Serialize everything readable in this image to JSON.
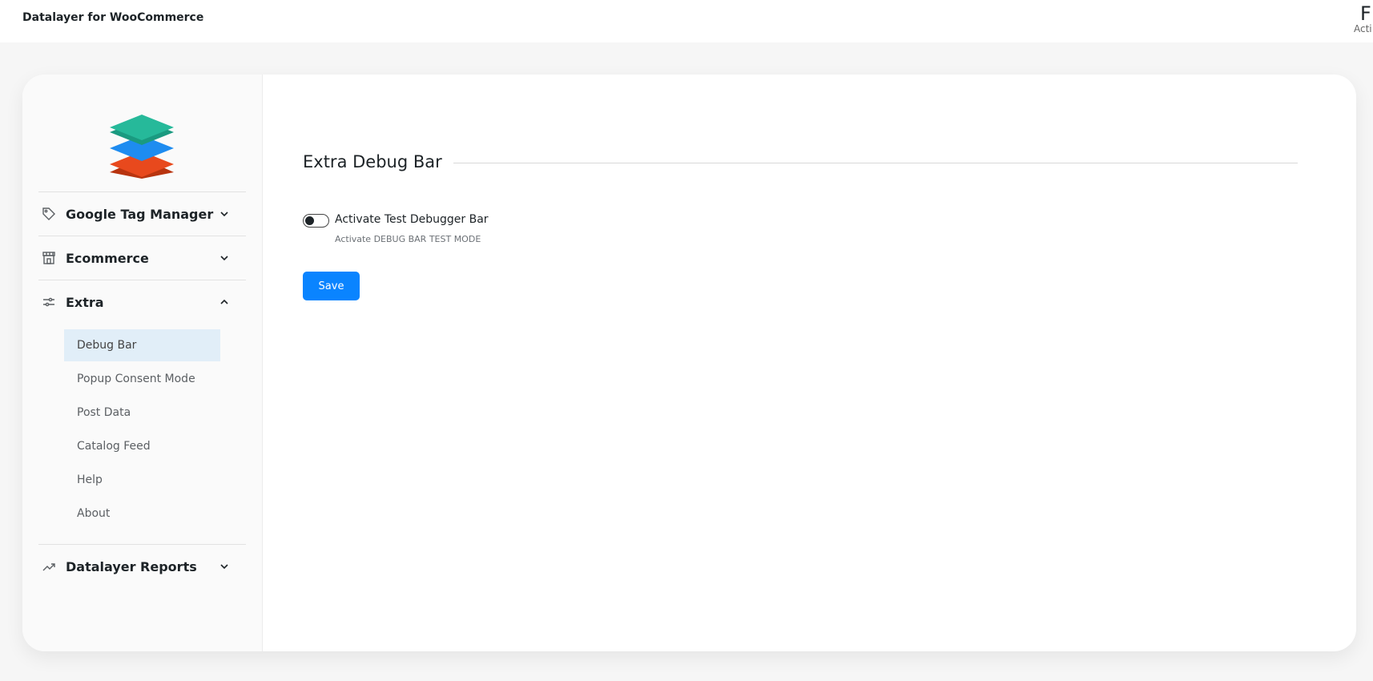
{
  "header": {
    "app_title": "Datalayer for WooCommerce",
    "right_big": "F",
    "right_small": "Acti"
  },
  "sidebar": {
    "logo": "stacked-layers-logo",
    "sections": [
      {
        "label": "Google Tag Manager",
        "icon": "tag-icon",
        "expanded": false
      },
      {
        "label": "Ecommerce",
        "icon": "store-icon",
        "expanded": false
      },
      {
        "label": "Extra",
        "icon": "sliders-icon",
        "expanded": true
      },
      {
        "label": "Datalayer Reports",
        "icon": "trend-up-icon",
        "expanded": false
      }
    ],
    "extra_items": [
      {
        "label": "Debug Bar",
        "active": true
      },
      {
        "label": "Popup Consent Mode",
        "active": false
      },
      {
        "label": "Post Data",
        "active": false
      },
      {
        "label": "Catalog Feed",
        "active": false
      },
      {
        "label": "Help",
        "active": false
      },
      {
        "label": "About",
        "active": false
      }
    ]
  },
  "main": {
    "title": "Extra Debug Bar",
    "toggle": {
      "label": "Activate Test Debugger Bar",
      "description": "Activate DEBUG BAR TEST MODE",
      "enabled": false
    },
    "save_label": "Save"
  },
  "colors": {
    "accent": "#0a84ff",
    "active_item_bg": "#e1eef8",
    "logo_top": "#26b99a",
    "logo_middle": "#1e8cf0",
    "logo_bottom": "#e8491d"
  }
}
